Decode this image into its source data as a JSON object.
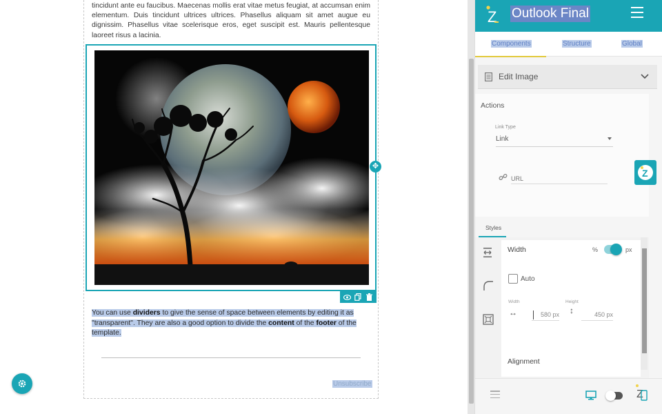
{
  "canvas": {
    "intro_text": "tincidunt ante eu faucibus. Maecenas mollis erat vitae metus feugiat, at accumsan enim elementum. Duis tincidunt ultrices ultrices. Phasellus aliquam sit amet augue eu dignissim. Phasellus vitae scelerisque eros, eget suscipit est. Mauris pellentesque laoreet risus a lacinia.",
    "divider_text": {
      "t1": "You can use ",
      "b1": "dividers",
      "t2": " to give the sense of space between elements by editing it as \"transparent\". They are also a good option to divide the ",
      "b2": "content",
      "t3": " of the ",
      "b3": "footer",
      "t4": " of the template."
    },
    "unsubscribe": "Unsubscribe"
  },
  "panel": {
    "title": "Outlook Final",
    "tabs": [
      "Components",
      "Structure",
      "Global"
    ],
    "edit_image_label": "Edit Image",
    "actions": {
      "section_label": "Actions",
      "link_type_label": "Link Type",
      "link_type_value": "Link",
      "url_placeholder": "URL"
    },
    "styles": {
      "tab_label": "Styles",
      "width_label": "Width",
      "percent_unit": "%",
      "px_unit": "px",
      "auto_label": "Auto",
      "width_small_label": "Width",
      "height_small_label": "Height",
      "width_value": "580 px",
      "height_value": "450 px",
      "alignment_label": "Alignment"
    }
  },
  "colors": {
    "accent": "#1aa5b5",
    "selection": "#b9cbe9",
    "title_highlight": "#6b86c6",
    "tab_underline": "#e2c93c"
  },
  "icons": [
    "move-icon",
    "eye-icon",
    "copy-icon",
    "trash-icon",
    "gear-icon",
    "menu-icon",
    "document-icon",
    "chevron-down-icon",
    "link-icon",
    "dimension-icon",
    "border-radius-icon",
    "padding-icon",
    "monitor-icon",
    "mobile-icon"
  ]
}
